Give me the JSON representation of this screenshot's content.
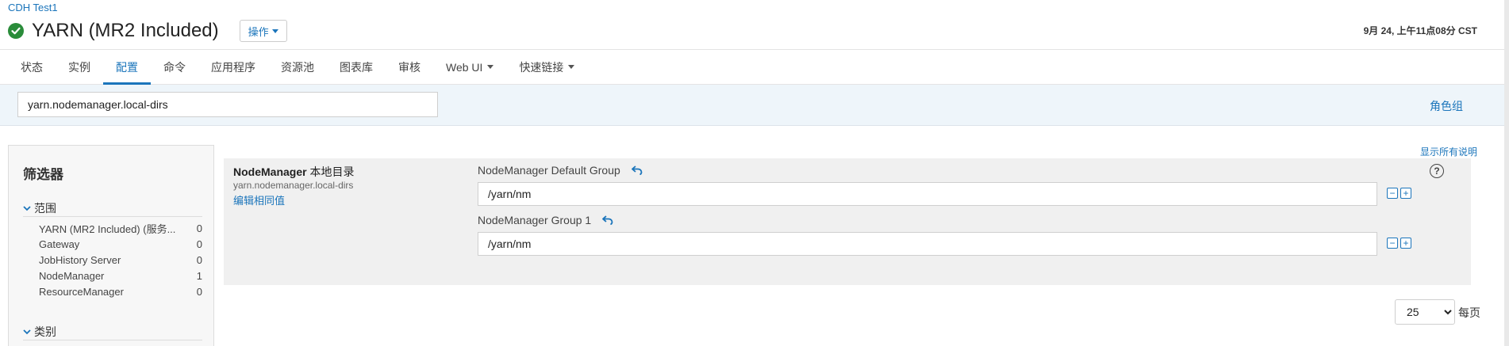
{
  "breadcrumb": "CDH Test1",
  "service": {
    "title": "YARN (MR2 Included)",
    "status_icon": "check-circle-icon",
    "status_color": "#2a8c3a"
  },
  "actions_label": "操作",
  "timestamp": "9月 24, 上午11点08分 CST",
  "tabs": [
    {
      "label": "状态"
    },
    {
      "label": "实例"
    },
    {
      "label": "配置"
    },
    {
      "label": "命令"
    },
    {
      "label": "应用程序"
    },
    {
      "label": "资源池"
    },
    {
      "label": "图表库"
    },
    {
      "label": "审核"
    },
    {
      "label": "Web UI"
    },
    {
      "label": "快速链接"
    }
  ],
  "active_tab": "配置",
  "search": {
    "value": "yarn.nodemanager.local-dirs"
  },
  "role_groups_link": "角色组",
  "filter": {
    "title": "筛选器",
    "scope": {
      "label": "范围",
      "items": [
        {
          "label": "YARN (MR2 Included) (服务...",
          "count": "0"
        },
        {
          "label": "Gateway",
          "count": "0"
        },
        {
          "label": "JobHistory Server",
          "count": "0"
        },
        {
          "label": "NodeManager",
          "count": "1"
        },
        {
          "label": "ResourceManager",
          "count": "0"
        }
      ]
    },
    "category": {
      "label": "类别"
    }
  },
  "show_all_desc": "显示所有说明",
  "property": {
    "name_bold": "NodeManager",
    "name_rest": " 本地目录",
    "key": "yarn.nodemanager.local-dirs",
    "edit_link": "编辑相同值",
    "groups": [
      {
        "label": "NodeManager Default Group",
        "value": "/yarn/nm"
      },
      {
        "label": "NodeManager Group 1",
        "value": "/yarn/nm"
      }
    ]
  },
  "pagination": {
    "page_size": "25",
    "per_page_label": "每页"
  },
  "accent_color": "#1b75bb"
}
